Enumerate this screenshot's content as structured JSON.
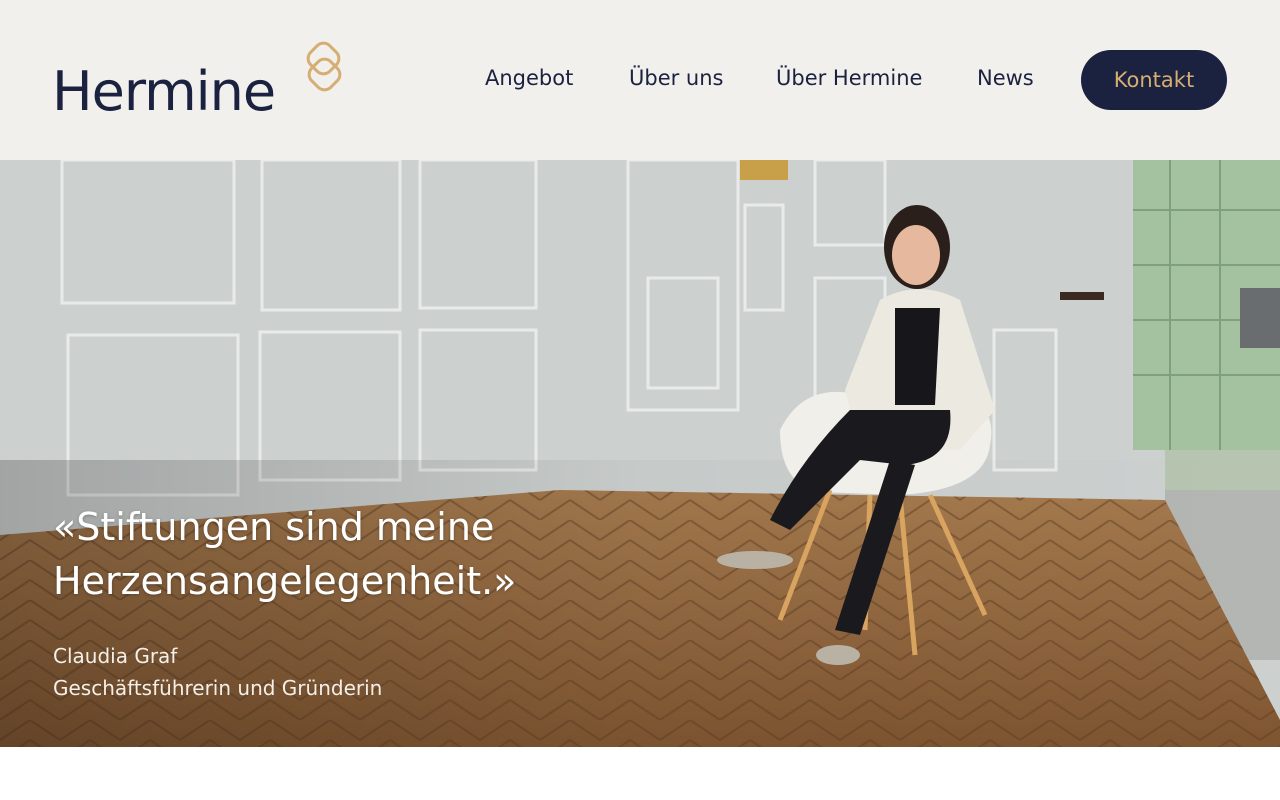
{
  "brand": {
    "name": "Hermine",
    "logo_text": "Hermine",
    "navy": "#1b2240",
    "gold": "#d6ad72",
    "header_bg": "#f1f0ec"
  },
  "nav": {
    "items": [
      {
        "label": "Angebot"
      },
      {
        "label": "Über uns"
      },
      {
        "label": "Über Hermine"
      },
      {
        "label": "News"
      }
    ],
    "cta_label": "Kontakt"
  },
  "hero": {
    "quote": "«Stiftungen sind meine Herzensangelegenheit.»",
    "author_name": "Claudia Graf",
    "author_role": "Geschäftsführerin und Gründerin"
  }
}
